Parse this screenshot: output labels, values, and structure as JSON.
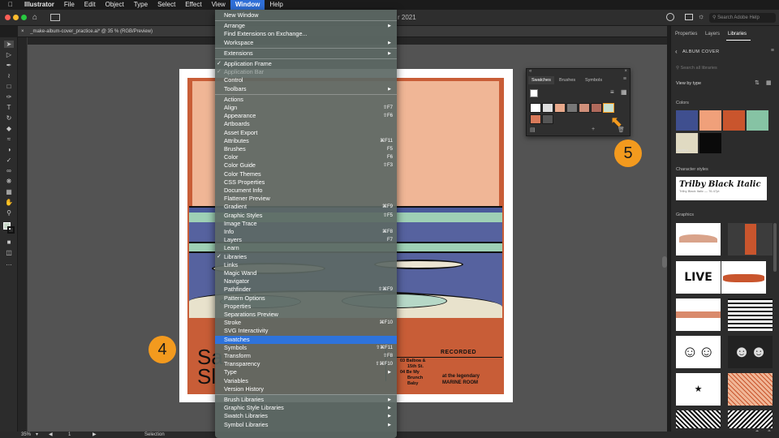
{
  "menubar": {
    "app_name": "Illustrator",
    "items": [
      "File",
      "Edit",
      "Object",
      "Type",
      "Select",
      "Effect",
      "View",
      "Window",
      "Help"
    ],
    "active": "Window"
  },
  "appbar": {
    "title_fragment": "r 2021",
    "search_placeholder": "Search Adobe Help"
  },
  "document": {
    "tab_title": "_make-album-cover_practice.ai* @ 35 % (RGB/Preview)"
  },
  "window_menu": {
    "items": [
      {
        "label": "New Window"
      },
      {
        "sep": true
      },
      {
        "label": "Arrange",
        "submenu": true
      },
      {
        "label": "Find Extensions on Exchange..."
      },
      {
        "label": "Workspace",
        "submenu": true
      },
      {
        "sep": true
      },
      {
        "label": "Extensions",
        "submenu": true
      },
      {
        "sep": true
      },
      {
        "label": "Application Frame",
        "checked": true
      },
      {
        "label": "Application Bar",
        "checked": true,
        "disabled": true
      },
      {
        "label": "Control"
      },
      {
        "label": "Toolbars",
        "submenu": true
      },
      {
        "sep": true
      },
      {
        "label": "Actions"
      },
      {
        "label": "Align",
        "shortcut": "⇧F7"
      },
      {
        "label": "Appearance",
        "shortcut": "⇧F6"
      },
      {
        "label": "Artboards"
      },
      {
        "label": "Asset Export"
      },
      {
        "label": "Attributes",
        "shortcut": "⌘F11"
      },
      {
        "label": "Brushes",
        "shortcut": "F5"
      },
      {
        "label": "Color",
        "shortcut": "F6"
      },
      {
        "label": "Color Guide",
        "shortcut": "⇧F3"
      },
      {
        "label": "Color Themes"
      },
      {
        "label": "CSS Properties"
      },
      {
        "label": "Document Info"
      },
      {
        "label": "Flattener Preview"
      },
      {
        "label": "Gradient",
        "shortcut": "⌘F9"
      },
      {
        "label": "Graphic Styles",
        "shortcut": "⇧F5"
      },
      {
        "label": "Image Trace"
      },
      {
        "label": "Info",
        "shortcut": "⌘F8"
      },
      {
        "label": "Layers",
        "shortcut": "F7"
      },
      {
        "label": "Learn"
      },
      {
        "label": "Libraries",
        "checked": true
      },
      {
        "label": "Links"
      },
      {
        "label": "Magic Wand"
      },
      {
        "label": "Navigator"
      },
      {
        "label": "Pathfinder",
        "shortcut": "⇧⌘F9"
      },
      {
        "label": "Pattern Options"
      },
      {
        "label": "Properties"
      },
      {
        "label": "Separations Preview"
      },
      {
        "label": "Stroke",
        "shortcut": "⌘F10"
      },
      {
        "label": "SVG Interactivity"
      },
      {
        "label": "Swatches",
        "highlighted": true
      },
      {
        "label": "Symbols",
        "shortcut": "⇧⌘F11"
      },
      {
        "label": "Transform",
        "shortcut": "⇧F8"
      },
      {
        "label": "Transparency",
        "shortcut": "⇧⌘F10"
      },
      {
        "label": "Type",
        "submenu": true
      },
      {
        "label": "Variables"
      },
      {
        "label": "Version History"
      },
      {
        "sep": true
      },
      {
        "label": "Brush Libraries",
        "submenu": true
      },
      {
        "label": "Graphic Style Libraries",
        "submenu": true
      },
      {
        "label": "Swatch Libraries",
        "submenu": true
      },
      {
        "label": "Symbol Libraries",
        "submenu": true
      }
    ]
  },
  "swatches_panel": {
    "tabs": [
      "Swatches",
      "Brushes",
      "Symbols"
    ],
    "active_tab": "Swatches"
  },
  "callouts": {
    "step4": "4",
    "step5": "5"
  },
  "artwork": {
    "left_text_1": "Sa",
    "left_text_2": "Sl",
    "recorded": "RECORDED",
    "track_line1": "03  Balboa &",
    "track_line2": "15th St.",
    "track_line3": "04  Be My",
    "track_line4": "Brunch",
    "track_line5": "Baby",
    "legend_line1": "at the legendary",
    "legend_line2": "MARINE ROOM"
  },
  "right_panel": {
    "tabs": [
      "Properties",
      "Layers",
      "Libraries"
    ],
    "active_tab": "Libraries",
    "library_name": "ALBUM COVER",
    "search_placeholder": "Search all libraries",
    "view_by": "View by type",
    "sections": {
      "colors": "Colors",
      "character_styles": "Character styles",
      "graphics": "Graphics"
    },
    "colors": [
      "#3f4f8f",
      "#f0a07a",
      "#c9552d",
      "#86c3a4",
      "#e0dac2",
      "#0a0a0a"
    ],
    "color_label": "#E0DA...",
    "char_style_name": "Trilby Black Italic",
    "char_style_meta": "Trilby Black Italic — 76.47pt",
    "graphic_live": "LIVE"
  },
  "status": {
    "zoom": "35%",
    "artboard": "1",
    "mode": "Selection"
  }
}
